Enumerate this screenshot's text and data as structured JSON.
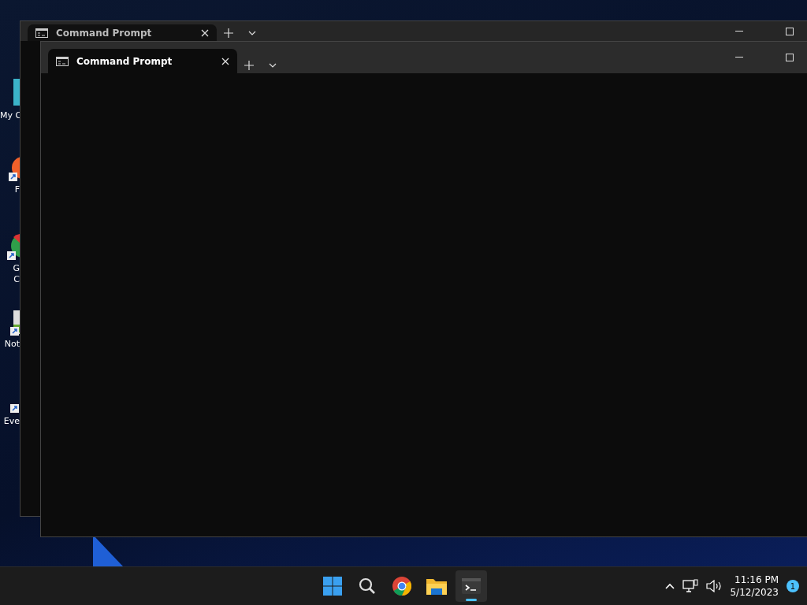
{
  "desktop_icons": [
    {
      "kind": "folder",
      "shortcut": false,
      "lines": [
        "My C"
      ]
    },
    {
      "kind": "fox",
      "shortcut": true,
      "lines": [
        "F"
      ]
    },
    {
      "kind": "globe",
      "shortcut": true,
      "lines": [
        "G",
        "C"
      ]
    },
    {
      "kind": "notepad",
      "shortcut": true,
      "lines": [
        "Not"
      ]
    },
    {
      "kind": "blank",
      "shortcut": true,
      "lines": [
        "Eve"
      ]
    }
  ],
  "windows": [
    {
      "tab_title": "Command Prompt",
      "active": false
    },
    {
      "tab_title": "Command Prompt",
      "active": true
    }
  ],
  "taskbar": {
    "apps": [
      {
        "kind": "start",
        "selected": false
      },
      {
        "kind": "search",
        "selected": false
      },
      {
        "kind": "chrome",
        "selected": false
      },
      {
        "kind": "explorer",
        "selected": false
      },
      {
        "kind": "terminal",
        "selected": true
      }
    ],
    "time": "11:16 PM",
    "date": "5/12/2023",
    "notifications": "1"
  }
}
